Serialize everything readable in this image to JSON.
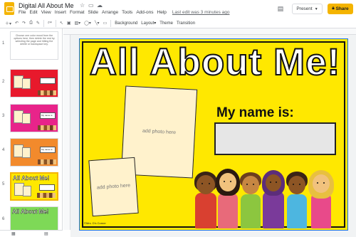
{
  "doc": {
    "title": "Digital All About Me",
    "star_icon": "star-icon",
    "folder_icon": "folder-icon",
    "cloud_icon": "cloud-icon"
  },
  "menu": [
    "File",
    "Edit",
    "View",
    "Insert",
    "Format",
    "Slide",
    "Arrange",
    "Tools",
    "Add-ons",
    "Help"
  ],
  "last_edit": "Last edit was 3 minutes ago",
  "header_buttons": {
    "present": "Present",
    "share": "Share"
  },
  "toolbar": {
    "background": "Background",
    "layout": "Layout",
    "theme": "Theme",
    "transition": "Transition"
  },
  "filmstrip": {
    "instructions": "Choose one color mood from the options here, then delete the rest by selecting the page and hitting the delete or backspace key.",
    "slides": [
      {
        "num": "1",
        "color": "#ffffff"
      },
      {
        "num": "2",
        "color": "#e8192c"
      },
      {
        "num": "3",
        "color": "#e8248a"
      },
      {
        "num": "4",
        "color": "#f28a2c"
      },
      {
        "num": "5",
        "color": "#ffe800"
      },
      {
        "num": "6",
        "color": "#7ed957"
      }
    ],
    "thumb_title": "All About Me!",
    "thumb_name_label": "My name is:"
  },
  "slide": {
    "title": "All About Me!",
    "photo_placeholder_1": "add photo here",
    "photo_placeholder_2": "add photo here",
    "name_label": "My name is:",
    "credit": "©Mrs. D's Corner",
    "background_color": "#ffe800"
  }
}
